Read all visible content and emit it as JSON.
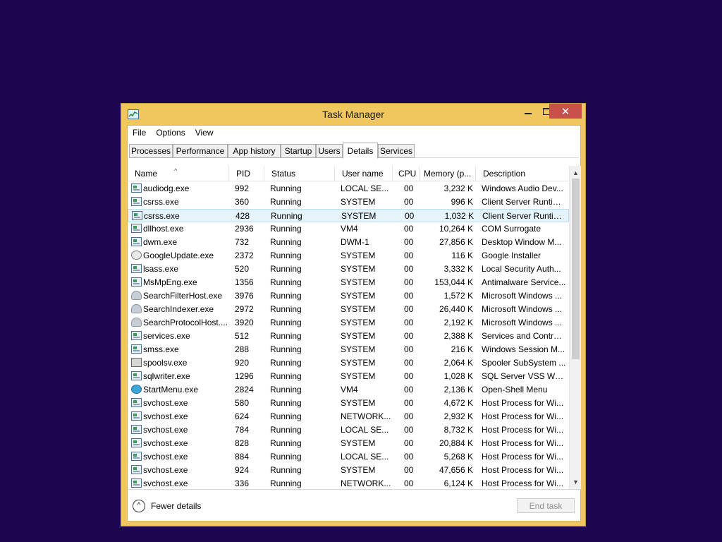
{
  "window": {
    "title": "Task Manager"
  },
  "menu": [
    "File",
    "Options",
    "View"
  ],
  "tabs": [
    "Processes",
    "Performance",
    "App history",
    "Startup",
    "Users",
    "Details",
    "Services"
  ],
  "active_tab": "Details",
  "columns": [
    "Name",
    "PID",
    "Status",
    "User name",
    "CPU",
    "Memory (p...",
    "Description"
  ],
  "rows": [
    {
      "name": "audiodg.exe",
      "pid": "992",
      "status": "Running",
      "user": "LOCAL SE...",
      "cpu": "00",
      "mem": "3,232 K",
      "desc": "Windows Audio Dev...",
      "icon": "exe-icon"
    },
    {
      "name": "csrss.exe",
      "pid": "360",
      "status": "Running",
      "user": "SYSTEM",
      "cpu": "00",
      "mem": "996 K",
      "desc": "Client Server Runtim...",
      "icon": "exe-icon"
    },
    {
      "name": "csrss.exe",
      "pid": "428",
      "status": "Running",
      "user": "SYSTEM",
      "cpu": "00",
      "mem": "1,032 K",
      "desc": "Client Server Runtim...",
      "icon": "exe-icon",
      "selected": true
    },
    {
      "name": "dllhost.exe",
      "pid": "2936",
      "status": "Running",
      "user": "VM4",
      "cpu": "00",
      "mem": "10,264 K",
      "desc": "COM Surrogate",
      "icon": "exe-icon"
    },
    {
      "name": "dwm.exe",
      "pid": "732",
      "status": "Running",
      "user": "DWM-1",
      "cpu": "00",
      "mem": "27,856 K",
      "desc": "Desktop Window M...",
      "icon": "exe-icon"
    },
    {
      "name": "GoogleUpdate.exe",
      "pid": "2372",
      "status": "Running",
      "user": "SYSTEM",
      "cpu": "00",
      "mem": "116 K",
      "desc": "Google Installer",
      "icon": "google-update-icon"
    },
    {
      "name": "lsass.exe",
      "pid": "520",
      "status": "Running",
      "user": "SYSTEM",
      "cpu": "00",
      "mem": "3,332 K",
      "desc": "Local Security Auth...",
      "icon": "exe-icon"
    },
    {
      "name": "MsMpEng.exe",
      "pid": "1356",
      "status": "Running",
      "user": "SYSTEM",
      "cpu": "00",
      "mem": "153,044 K",
      "desc": "Antimalware Service...",
      "icon": "exe-icon"
    },
    {
      "name": "SearchFilterHost.exe",
      "pid": "3976",
      "status": "Running",
      "user": "SYSTEM",
      "cpu": "00",
      "mem": "1,572 K",
      "desc": "Microsoft Windows ...",
      "icon": "search-user-icon"
    },
    {
      "name": "SearchIndexer.exe",
      "pid": "2972",
      "status": "Running",
      "user": "SYSTEM",
      "cpu": "00",
      "mem": "26,440 K",
      "desc": "Microsoft Windows ...",
      "icon": "search-user-icon"
    },
    {
      "name": "SearchProtocolHost....",
      "pid": "3920",
      "status": "Running",
      "user": "SYSTEM",
      "cpu": "00",
      "mem": "2,192 K",
      "desc": "Microsoft Windows ...",
      "icon": "search-user-icon"
    },
    {
      "name": "services.exe",
      "pid": "512",
      "status": "Running",
      "user": "SYSTEM",
      "cpu": "00",
      "mem": "2,388 K",
      "desc": "Services and Control...",
      "icon": "exe-icon"
    },
    {
      "name": "smss.exe",
      "pid": "288",
      "status": "Running",
      "user": "SYSTEM",
      "cpu": "00",
      "mem": "216 K",
      "desc": "Windows Session M...",
      "icon": "exe-icon"
    },
    {
      "name": "spoolsv.exe",
      "pid": "920",
      "status": "Running",
      "user": "SYSTEM",
      "cpu": "00",
      "mem": "2,064 K",
      "desc": "Spooler SubSystem ...",
      "icon": "printer-icon"
    },
    {
      "name": "sqlwriter.exe",
      "pid": "1296",
      "status": "Running",
      "user": "SYSTEM",
      "cpu": "00",
      "mem": "1,028 K",
      "desc": "SQL Server VSS Writ...",
      "icon": "exe-icon"
    },
    {
      "name": "StartMenu.exe",
      "pid": "2824",
      "status": "Running",
      "user": "VM4",
      "cpu": "00",
      "mem": "2,136 K",
      "desc": "Open-Shell Menu",
      "icon": "globe-icon"
    },
    {
      "name": "svchost.exe",
      "pid": "580",
      "status": "Running",
      "user": "SYSTEM",
      "cpu": "00",
      "mem": "4,672 K",
      "desc": "Host Process for Wi...",
      "icon": "exe-icon"
    },
    {
      "name": "svchost.exe",
      "pid": "624",
      "status": "Running",
      "user": "NETWORK...",
      "cpu": "00",
      "mem": "2,932 K",
      "desc": "Host Process for Wi...",
      "icon": "exe-icon"
    },
    {
      "name": "svchost.exe",
      "pid": "784",
      "status": "Running",
      "user": "LOCAL SE...",
      "cpu": "00",
      "mem": "8,732 K",
      "desc": "Host Process for Wi...",
      "icon": "exe-icon"
    },
    {
      "name": "svchost.exe",
      "pid": "828",
      "status": "Running",
      "user": "SYSTEM",
      "cpu": "00",
      "mem": "20,884 K",
      "desc": "Host Process for Wi...",
      "icon": "exe-icon"
    },
    {
      "name": "svchost.exe",
      "pid": "884",
      "status": "Running",
      "user": "LOCAL SE...",
      "cpu": "00",
      "mem": "5,268 K",
      "desc": "Host Process for Wi...",
      "icon": "exe-icon"
    },
    {
      "name": "svchost.exe",
      "pid": "924",
      "status": "Running",
      "user": "SYSTEM",
      "cpu": "00",
      "mem": "47,656 K",
      "desc": "Host Process for Wi...",
      "icon": "exe-icon"
    },
    {
      "name": "svchost.exe",
      "pid": "336",
      "status": "Running",
      "user": "NETWORK...",
      "cpu": "00",
      "mem": "6,124 K",
      "desc": "Host Process for Wi...",
      "icon": "exe-icon"
    }
  ],
  "footer": {
    "fewer_details": "Fewer details",
    "end_task": "End task"
  },
  "colors": {
    "desktop": "#1c0650",
    "window_frame": "#f0c75e",
    "close_button": "#c7504a",
    "selection": "#e5f3fb"
  }
}
